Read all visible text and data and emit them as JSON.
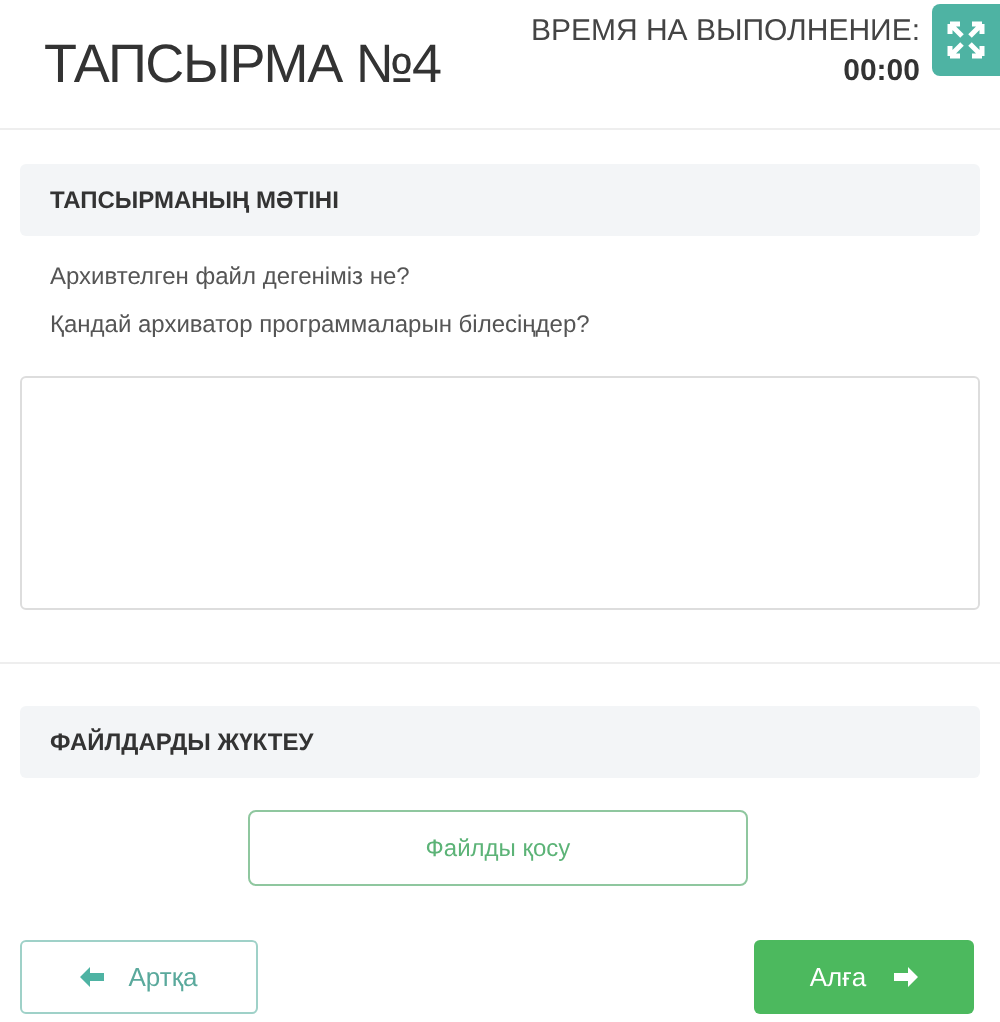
{
  "header": {
    "title": "ТАПСЫРМА №4",
    "timer_label": "ВРЕМЯ НА ВЫПОЛНЕНИЕ:",
    "timer_value": "00:00"
  },
  "task": {
    "heading": "ТАПСЫРМАНЫҢ МӘТІНІ",
    "lines": [
      "Архивтелген файл дегеніміз не?",
      "Қандай архиватор программаларын білесіңдер?"
    ]
  },
  "files": {
    "heading": "ФАЙЛДАРДЫ ЖҮКТЕУ",
    "add_button": "Файлды қосу"
  },
  "nav": {
    "back": "Артқа",
    "next": "Алға"
  }
}
